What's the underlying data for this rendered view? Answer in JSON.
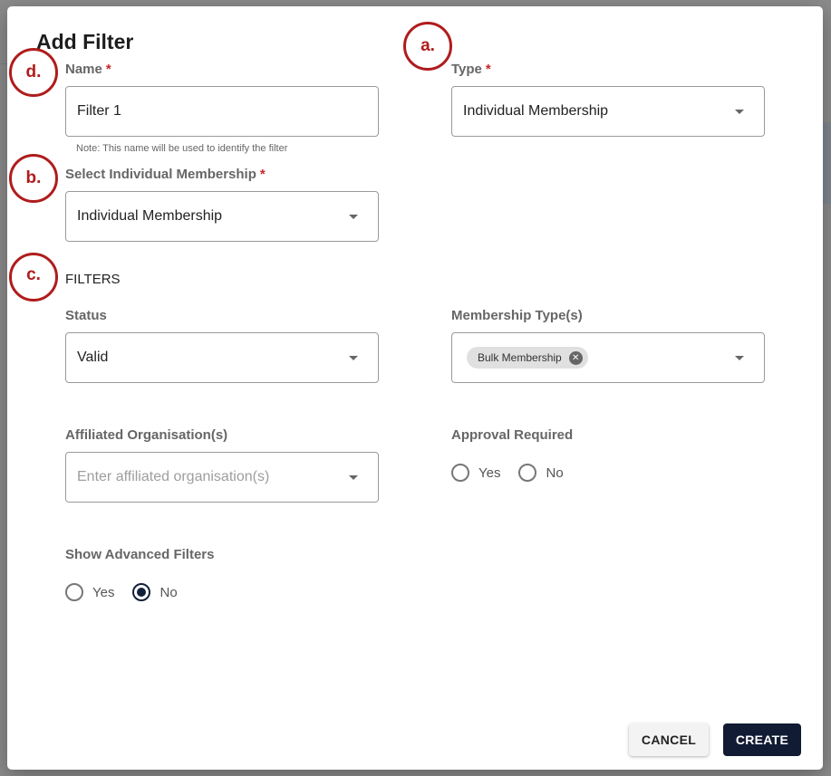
{
  "dialog": {
    "title": "Add Filter",
    "name": {
      "label": "Name",
      "required": "*",
      "value": "Filter 1",
      "note": "Note: This name will be used to identify the filter"
    },
    "type": {
      "label": "Type",
      "required": "*",
      "value": "Individual Membership"
    },
    "select_membership": {
      "label": "Select Individual Membership",
      "required": "*",
      "value": "Individual Membership"
    },
    "filters_heading": "FILTERS",
    "status": {
      "label": "Status",
      "value": "Valid"
    },
    "membership_types": {
      "label": "Membership Type(s)",
      "chips": [
        "Bulk Membership"
      ]
    },
    "affiliated": {
      "label": "Affiliated Organisation(s)",
      "placeholder": "Enter affiliated organisation(s)"
    },
    "approval": {
      "label": "Approval Required",
      "options": [
        "Yes",
        "No"
      ],
      "selected": null
    },
    "advanced": {
      "label": "Show Advanced Filters",
      "options": [
        "Yes",
        "No"
      ],
      "selected": "No"
    },
    "cancel_label": "CANCEL",
    "create_label": "CREATE"
  },
  "annotations": {
    "a": "a.",
    "b": "b.",
    "c": "c.",
    "d": "d."
  },
  "colors": {
    "primary": "#111b33",
    "annotation": "#b01c1c",
    "required": "#c62828"
  }
}
